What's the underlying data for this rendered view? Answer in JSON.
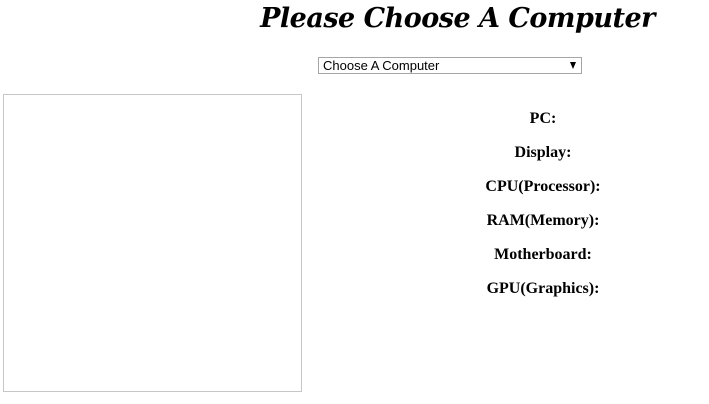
{
  "header": {
    "title": "Please Choose A Computer"
  },
  "computer_select": {
    "selected": "Choose A Computer",
    "icon": "dropdown-arrow-icon"
  },
  "specs": [
    {
      "label": "PC:"
    },
    {
      "label": "Display:"
    },
    {
      "label": "CPU(Processor):"
    },
    {
      "label": "RAM(Memory):"
    },
    {
      "label": "Motherboard:"
    },
    {
      "label": "GPU(Graphics):"
    }
  ]
}
